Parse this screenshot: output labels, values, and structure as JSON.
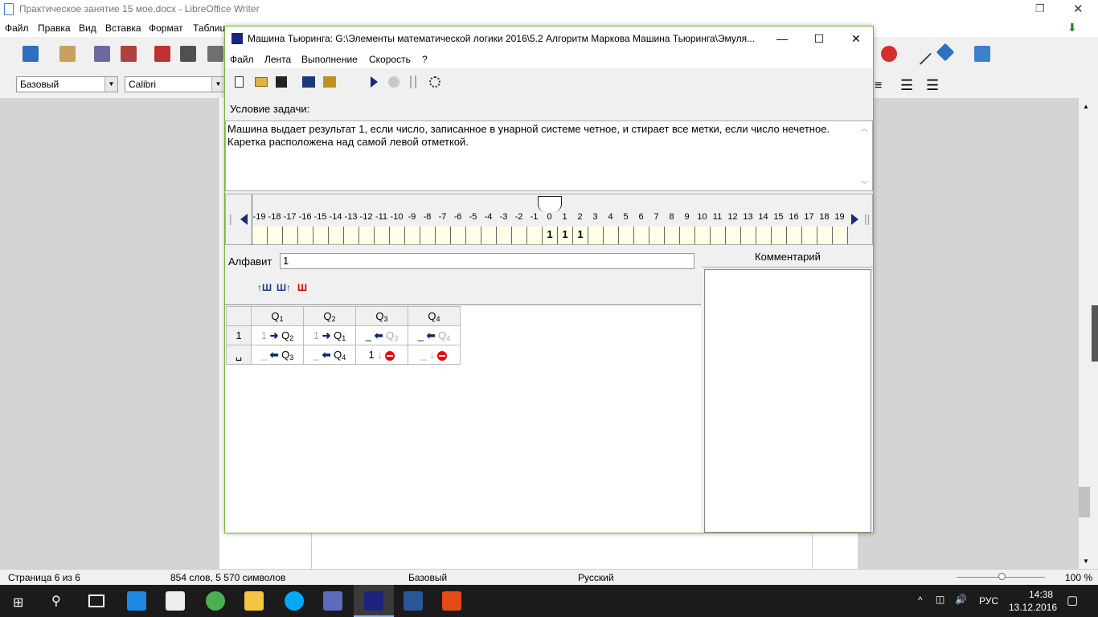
{
  "lo": {
    "title": "Практическое занятие 15 мое.docx - LibreOffice Writer",
    "menu": [
      "Файл",
      "Правка",
      "Вид",
      "Вставка",
      "Формат",
      "Таблица"
    ],
    "style_value": "Базовый",
    "font_value": "Calibri",
    "status": {
      "page": "Страница 6 из 6",
      "words": "854 слов, 5 570 символов",
      "style": "Базовый",
      "lang": "Русский",
      "zoom": "100 %"
    }
  },
  "taskbar": {
    "lang": "РУС",
    "time": "14:38",
    "date": "13.12.2016"
  },
  "dialog": {
    "title": "Машина Тьюринга: G:\\Элементы математической логики 2016\\5.2 Алгоритм Маркова Машина Тьюринга\\Эмуля...",
    "menu": [
      "Файл",
      "Лента",
      "Выполнение",
      "Скорость",
      "?"
    ],
    "condition_label": "Условие задачи:",
    "condition_text": "Машина выдает результат 1, если число, записанное в унарной системе четное, и стирает все метки, если число нечетное. Каретка расположена над самой левой отметкой.",
    "alphabet_label": "Алфавит",
    "alphabet_value": "1",
    "comment_label": "Комментарий",
    "tape": {
      "labels": [
        "-19",
        "-18",
        "-17",
        "-16",
        "-15",
        "-14",
        "-13",
        "-12",
        "-11",
        "-10",
        "-9",
        "-8",
        "-7",
        "-6",
        "-5",
        "-4",
        "-3",
        "-2",
        "-1",
        "0",
        "1",
        "2",
        "3",
        "4",
        "5",
        "6",
        "7",
        "8",
        "9",
        "10",
        "11",
        "12",
        "13",
        "14",
        "15",
        "16",
        "17",
        "18",
        "19"
      ],
      "cells": [
        "",
        "",
        "",
        "",
        "",
        "",
        "",
        "",
        "",
        "",
        "",
        "",
        "",
        "",
        "",
        "",
        "",
        "",
        "",
        "1",
        "1",
        "1",
        "",
        "",
        "",
        "",
        "",
        "",
        "",
        "",
        "",
        "",
        "",
        "",
        "",
        "",
        "",
        "",
        ""
      ],
      "head_position": "0"
    },
    "table": {
      "states": [
        "Q1",
        "Q2",
        "Q3",
        "Q4"
      ],
      "rows": [
        {
          "symbol": "1",
          "cells": [
            {
              "write": "1",
              "move": "right",
              "next": "Q2",
              "write_gray": true,
              "next_gray": false
            },
            {
              "write": "1",
              "move": "right",
              "next": "Q1",
              "write_gray": true,
              "next_gray": false
            },
            {
              "write": "_",
              "move": "left",
              "next": "Q3",
              "write_gray": false,
              "next_gray": true
            },
            {
              "write": "_",
              "move": "left",
              "next": "Q4",
              "write_gray": false,
              "next_gray": true
            }
          ]
        },
        {
          "symbol": "␣",
          "cells": [
            {
              "write": "_",
              "move": "left",
              "next": "Q3",
              "write_gray": true,
              "next_gray": false
            },
            {
              "write": "_",
              "move": "left",
              "next": "Q4",
              "write_gray": true,
              "next_gray": false
            },
            {
              "write": "1",
              "move": "stay",
              "next": "stop",
              "write_gray": false,
              "next_gray": false
            },
            {
              "write": "_",
              "move": "stay",
              "next": "stop",
              "write_gray": true,
              "next_gray": false
            }
          ]
        }
      ]
    }
  }
}
